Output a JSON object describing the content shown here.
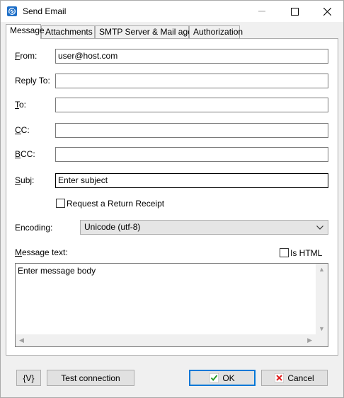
{
  "window": {
    "title": "Send Email"
  },
  "tabs": [
    {
      "label": "Message",
      "active": true
    },
    {
      "label": "Attachments",
      "active": false
    },
    {
      "label": "SMTP Server & Mail agent",
      "active": false
    },
    {
      "label": "Authorization",
      "active": false
    }
  ],
  "form": {
    "from": {
      "label_u": "F",
      "label_rest": "rom:",
      "value": "user@host.com"
    },
    "reply_to": {
      "label": "Reply To:",
      "value": ""
    },
    "to": {
      "label_u": "T",
      "label_rest": "o:",
      "value": ""
    },
    "cc": {
      "label_u": "C",
      "label_rest": "C:",
      "value": ""
    },
    "bcc": {
      "label_u": "B",
      "label_rest": "CC:",
      "value": ""
    },
    "subj": {
      "label_u": "S",
      "label_rest": "ubj:",
      "value": "Enter subject"
    },
    "return_receipt": {
      "label": "Request a Return Receipt",
      "checked": false
    },
    "encoding": {
      "label": "Encoding:",
      "value": "Unicode (utf-8)"
    },
    "message": {
      "label_u": "M",
      "label_rest": "essage text:",
      "value": "Enter message body"
    },
    "is_html": {
      "label": "Is HTML",
      "checked": false
    }
  },
  "buttons": {
    "vars": "{V}",
    "test_connection": "Test connection",
    "ok": "OK",
    "cancel": "Cancel"
  },
  "colors": {
    "ok_check": "#2a9d2a",
    "cancel_x": "#e02020",
    "default_border": "#0078d7"
  },
  "icons": {
    "app": "email-send-icon",
    "ok": "check-icon",
    "cancel": "x-icon"
  }
}
